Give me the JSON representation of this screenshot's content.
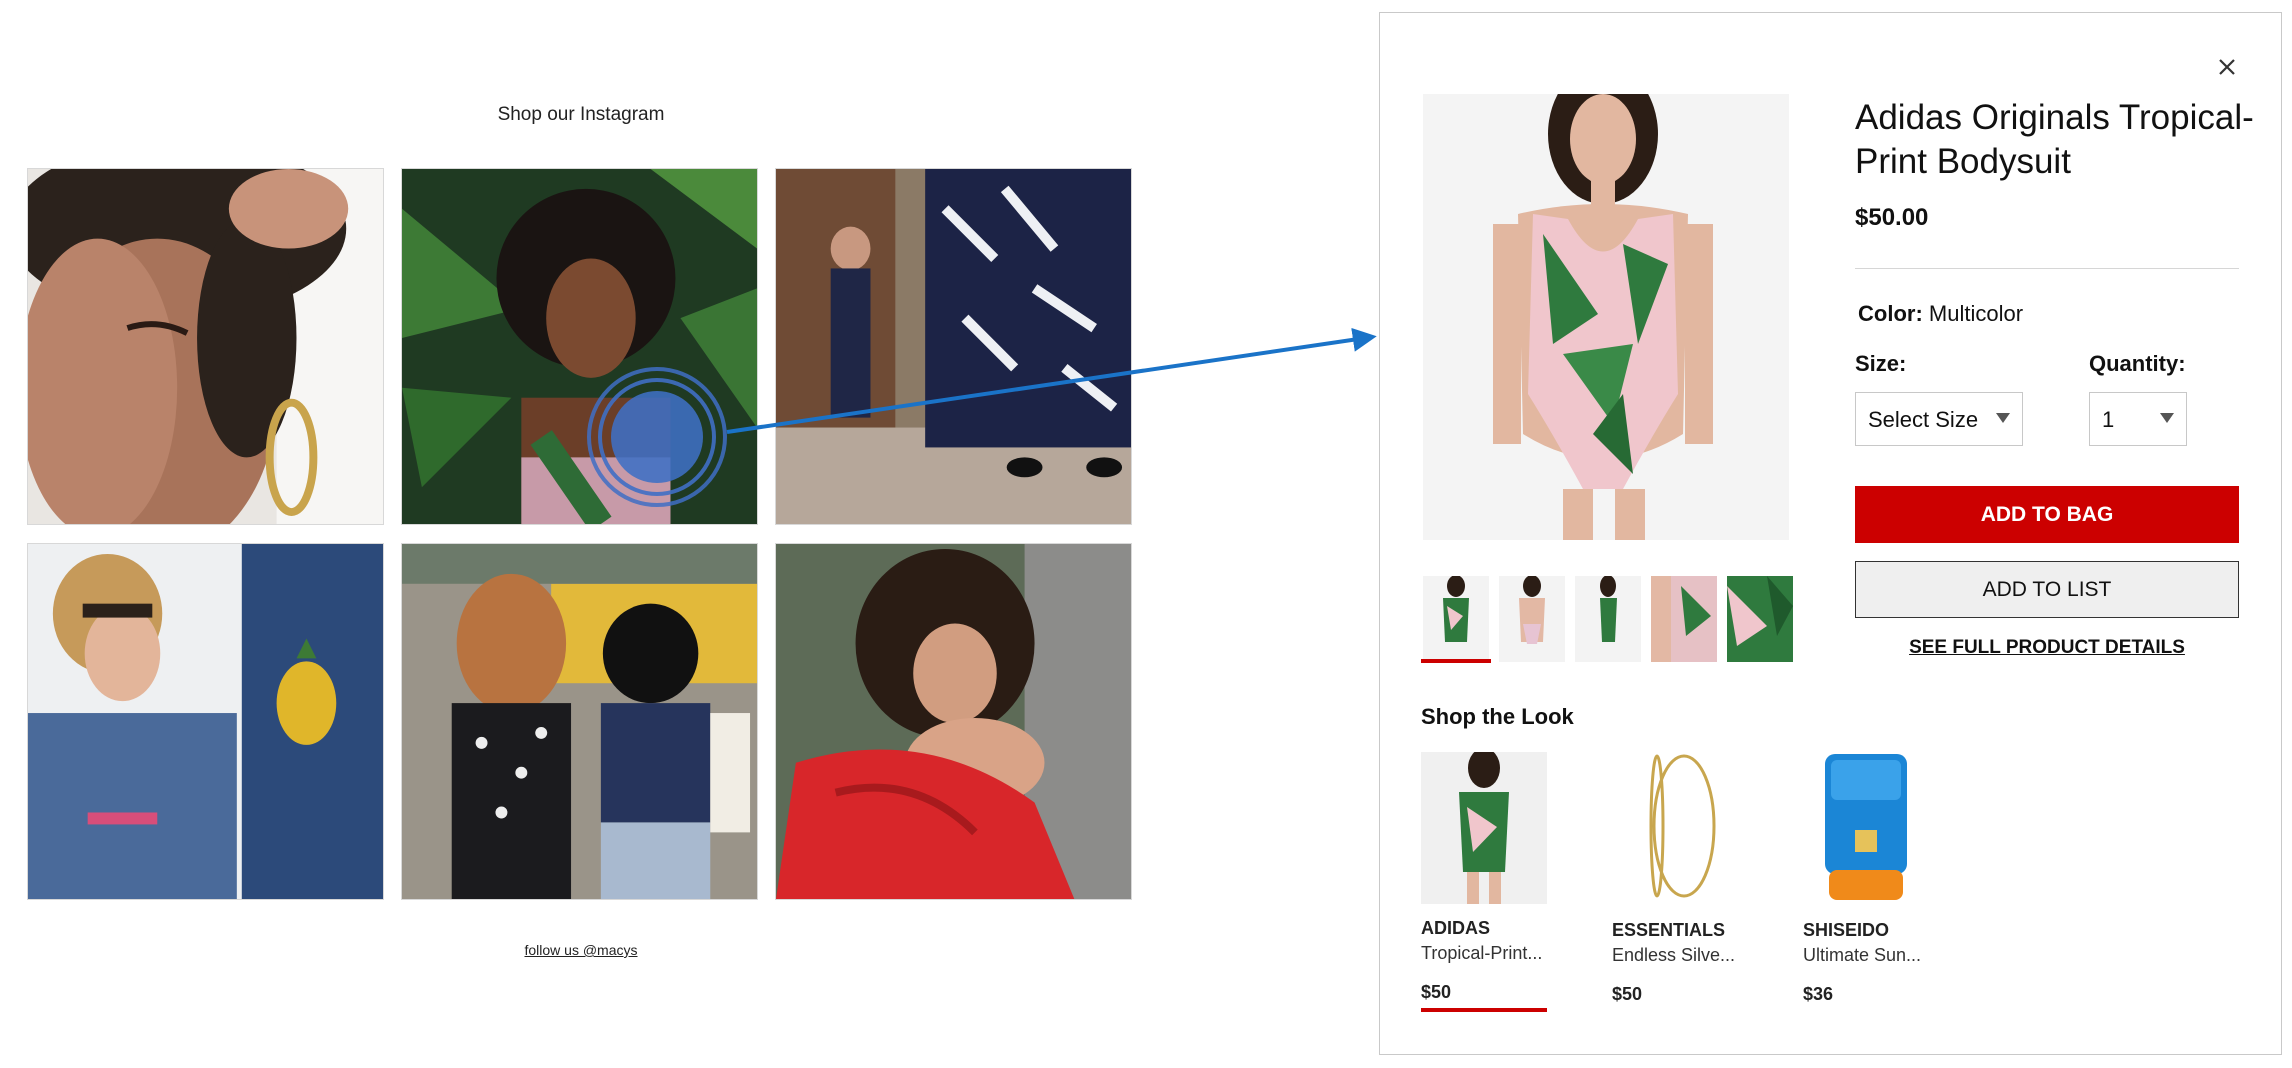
{
  "gallery": {
    "title": "Shop our Instagram",
    "follow_link": "follow us @macys"
  },
  "colors": {
    "accent_red": "#cc0000",
    "hotspot_blue": "#3f6fc4",
    "arrow_blue": "#1a73c8"
  },
  "modal": {
    "close_icon": "close-icon",
    "product_title": "Adidas Originals Tropical-Print Bodysuit",
    "price": "$50.00",
    "color_label": "Color:",
    "color_value": "Multicolor",
    "size_label": "Size:",
    "size_value": "Select Size",
    "quantity_label": "Quantity:",
    "quantity_value": "1",
    "add_to_bag": "ADD TO BAG",
    "add_to_list": "ADD TO LIST",
    "full_details": "SEE FULL PRODUCT DETAILS",
    "selected_thumbnail": 1,
    "shop_the_look": {
      "title": "Shop the Look",
      "items": [
        {
          "brand": "ADIDAS",
          "name": "Tropical-Print...",
          "price": "$50"
        },
        {
          "brand": "ESSENTIALS",
          "name": "Endless Silve...",
          "price": "$50"
        },
        {
          "brand": "SHISEIDO",
          "name": "Ultimate Sun...",
          "price": "$36"
        }
      ]
    }
  }
}
